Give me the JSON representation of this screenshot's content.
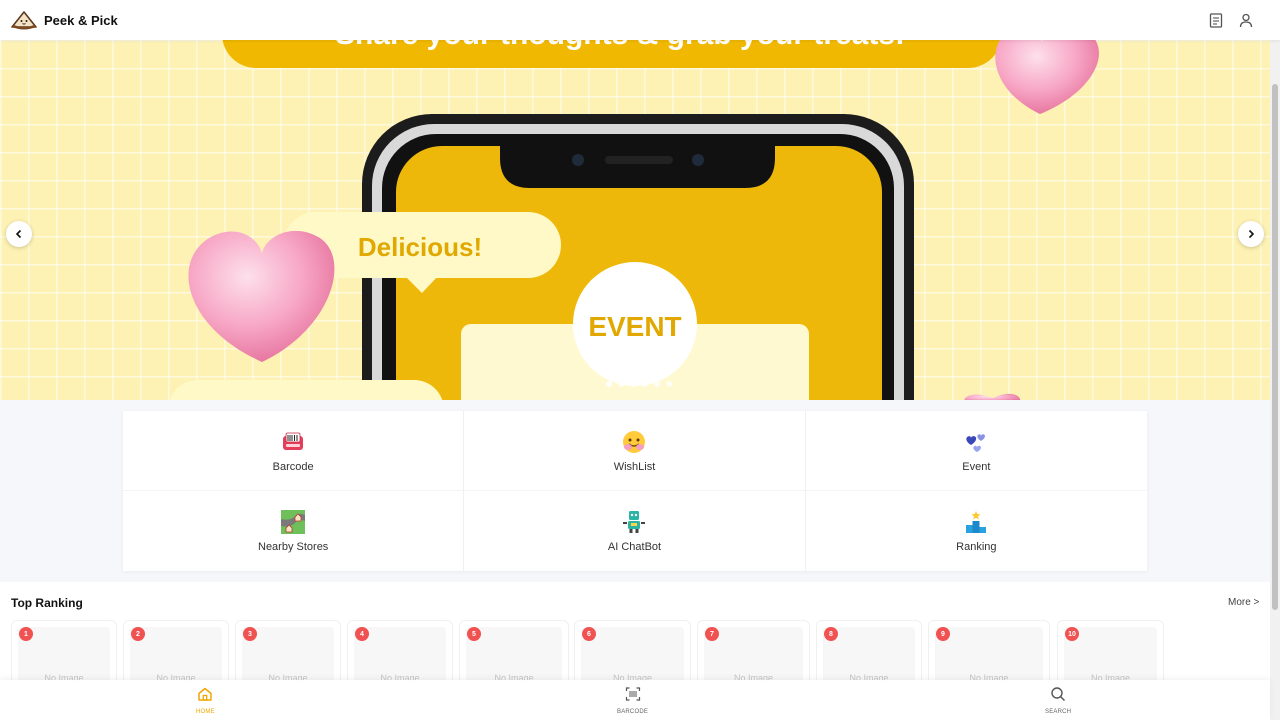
{
  "app": {
    "name": "Peek & Pick"
  },
  "topbar": {
    "icons": [
      "document-icon",
      "user-icon"
    ]
  },
  "hero": {
    "banner_headline": "Share your thoughts & grab your treats!",
    "bubble_text": "Delicious!",
    "event_text": "EVENT",
    "slide_count": 6,
    "active_slide": 1,
    "colors": {
      "background": "#fdf2b3",
      "accent": "#f0b800",
      "heart": "#f7a6c4"
    }
  },
  "quick_menu": [
    {
      "label": "Barcode",
      "icon": "barcode-scanner-icon"
    },
    {
      "label": "WishList",
      "icon": "smiling-face-icon"
    },
    {
      "label": "Event",
      "icon": "hearts-icon"
    },
    {
      "label": "Nearby Stores",
      "icon": "map-icon"
    },
    {
      "label": "AI ChatBot",
      "icon": "robot-icon"
    },
    {
      "label": "Ranking",
      "icon": "podium-icon"
    }
  ],
  "ranking": {
    "title": "Top Ranking",
    "more_label": "More >",
    "placeholder": "No Image",
    "items": [
      "1",
      "2",
      "3",
      "4",
      "5",
      "6",
      "7",
      "8",
      "9",
      "10"
    ]
  },
  "bottom_nav": [
    {
      "label": "HOME",
      "icon": "home-icon",
      "active": true
    },
    {
      "label": "BARCODE",
      "icon": "barcode-icon",
      "active": false
    },
    {
      "label": "SEARCH",
      "icon": "search-icon",
      "active": false
    }
  ]
}
